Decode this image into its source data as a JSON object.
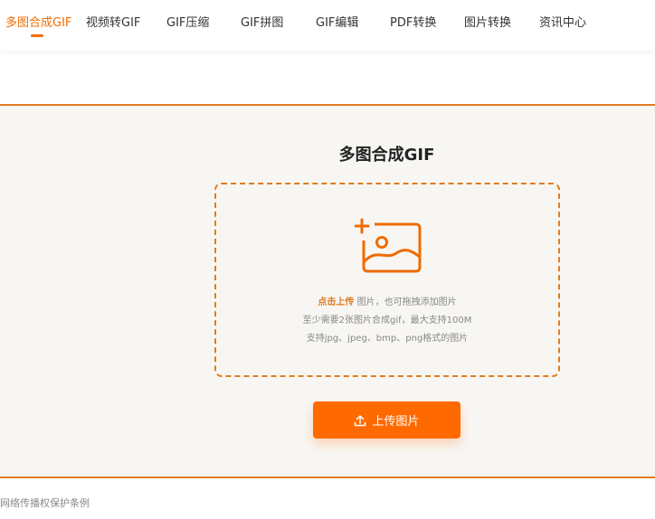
{
  "nav": {
    "items": [
      {
        "label": "多图合成GIF",
        "active": true
      },
      {
        "label": "视频转GIF"
      },
      {
        "label": "GIF压缩"
      },
      {
        "label": "GIF拼图"
      },
      {
        "label": "GIF编辑"
      },
      {
        "label": "PDF转换"
      },
      {
        "label": "图片转换"
      },
      {
        "label": "资讯中心"
      }
    ]
  },
  "main": {
    "title": "多图合成GIF",
    "dropzone": {
      "icon": "add-image-icon",
      "click_upload": "点击上传",
      "line1_rest": " 图片，也可拖拽添加图片",
      "line2": "至少需要2张图片合成gif，最大支持100M",
      "line3": "支持jpg、jpeg、bmp、png格式的图片"
    },
    "upload_button": {
      "icon": "upload-icon",
      "label": "上传图片"
    }
  },
  "footer": {
    "link": "网络传播权保护条例"
  },
  "colors": {
    "accent": "#ef6c00",
    "button": "#ff6a00",
    "panel_bg": "#f8f6f3",
    "border": "#e07b1e"
  }
}
